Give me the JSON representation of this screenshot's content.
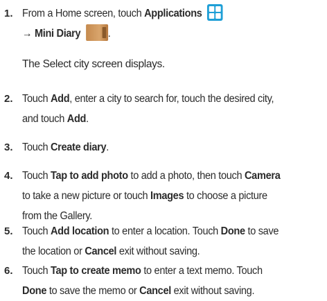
{
  "steps": [
    {
      "number": "1.",
      "parts": [
        "From a Home screen, touch ",
        "Applications",
        "→ Mini Diary",
        "."
      ],
      "note": "The Select city screen displays."
    },
    {
      "number": "2.",
      "line1": [
        "Touch ",
        "Add",
        ", enter a city to search for, touch the desired city,"
      ],
      "line2": [
        "and touch ",
        "Add",
        "."
      ]
    },
    {
      "number": "3.",
      "line1": [
        "Touch ",
        "Create diary",
        "."
      ]
    },
    {
      "number": "4.",
      "line1": [
        "Touch ",
        "Tap to add photo",
        " to add a photo, then touch ",
        "Camera"
      ],
      "line2": [
        "to take a new picture or touch ",
        "Images",
        " to choose a picture"
      ],
      "line3": [
        "from the Gallery."
      ]
    },
    {
      "number": "5.",
      "line1": [
        "Touch ",
        "Add location",
        " to enter a location. Touch ",
        "Done",
        " to save"
      ],
      "line2": [
        "the location or ",
        "Cancel",
        " exit without saving."
      ]
    },
    {
      "number": "6.",
      "line1": [
        "Touch ",
        "Tap to create memo",
        " to enter a text memo. Touch"
      ],
      "line2": [
        "Done",
        " to save the memo or ",
        "Cancel",
        " exit without saving."
      ]
    }
  ],
  "icons": {
    "applications": "applications-grid-icon",
    "mini_diary": "mini-diary-icon"
  },
  "colors": {
    "text": "#2b2b2b",
    "applications_icon": "#1f9fd6",
    "diary_icon": "#c58a4e"
  }
}
